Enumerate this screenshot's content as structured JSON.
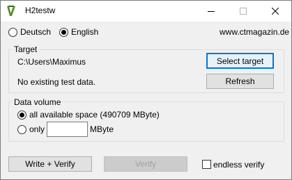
{
  "window": {
    "title": "H2testw"
  },
  "language": {
    "options": [
      {
        "label": "Deutsch",
        "selected": false
      },
      {
        "label": "English",
        "selected": true
      }
    ],
    "website": "www.ctmagazin.de"
  },
  "target": {
    "group_title": "Target",
    "path": "C:\\Users\\Maximus",
    "status": "No existing test data.",
    "select_label": "Select target",
    "refresh_label": "Refresh"
  },
  "data_volume": {
    "group_title": "Data volume",
    "all_space_label": "all available space (490709 MByte)",
    "all_space_selected": true,
    "only_label": "only",
    "only_selected": false,
    "only_value": "",
    "unit": "MByte"
  },
  "actions": {
    "write_verify_label": "Write + Verify",
    "verify_label": "Verify",
    "endless_verify_label": "endless verify",
    "endless_verify_checked": false
  }
}
